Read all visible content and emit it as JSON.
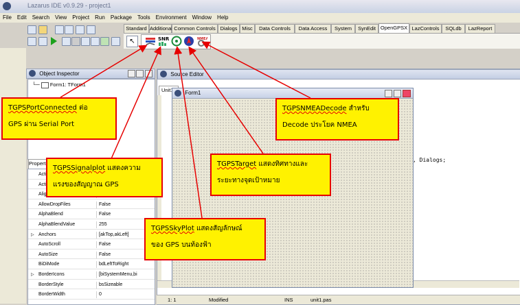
{
  "window": {
    "title": "Lazarus IDE v0.9.29 - project1"
  },
  "menu": [
    "File",
    "Edit",
    "Search",
    "View",
    "Project",
    "Run",
    "Package",
    "Tools",
    "Environment",
    "Window",
    "Help"
  ],
  "palette_tabs": [
    "Standard",
    "Additional",
    "Common Controls",
    "Dialogs",
    "Misc",
    "Data Controls",
    "Data Access",
    "System",
    "SynEdit",
    "OpenGPSX",
    "LazControls",
    "SQLdb",
    "LazReport"
  ],
  "active_tab": "OpenGPSX",
  "palette_components": [
    {
      "name": "TGPSPortConnected",
      "icon": "gps-port-icon"
    },
    {
      "name": "TGPSSignalplot",
      "icon": "snr-signal-icon"
    },
    {
      "name": "TGPSSkyPlot",
      "icon": "sky-plot-icon"
    },
    {
      "name": "TGPSTarget",
      "icon": "target-icon"
    },
    {
      "name": "TGPSNMEADecode",
      "icon": "nmea-decode-icon"
    }
  ],
  "object_inspector": {
    "title": "Object Inspector",
    "tree_item": "Form1: TForm1",
    "tab": "Properties",
    "properties": [
      {
        "k": "Action",
        "v": ""
      },
      {
        "k": "ActiveControl",
        "v": ""
      },
      {
        "k": "Align",
        "v": ""
      },
      {
        "k": "AllowDropFiles",
        "v": "False"
      },
      {
        "k": "AlphaBlend",
        "v": "False"
      },
      {
        "k": "AlphaBlendValue",
        "v": "255"
      },
      {
        "k": "Anchors",
        "v": "[akTop,akLeft]",
        "expand": true
      },
      {
        "k": "AutoScroll",
        "v": "False"
      },
      {
        "k": "AutoSize",
        "v": "False"
      },
      {
        "k": "BiDiMode",
        "v": "bdLeftToRight"
      },
      {
        "k": "BorderIcons",
        "v": "[biSystemMenu,bi",
        "expand": true
      },
      {
        "k": "BorderStyle",
        "v": "bsSizeable"
      },
      {
        "k": "BorderWidth",
        "v": "0"
      }
    ]
  },
  "source_editor": {
    "title": "Source Editor",
    "tab": "Unit1",
    "code_fragment": ", Dialogs;"
  },
  "form1": {
    "title": "Form1"
  },
  "statusbar": {
    "pos": "1: 1",
    "state": "Modified",
    "mode": "INS",
    "file": "unit1.pas"
  },
  "callouts": {
    "port": {
      "name": "TGPSPortConnected",
      "text1": " ต่อ",
      "text2": "GPS ผ่าน Serial Port"
    },
    "signal": {
      "name": "TGPSSignalplot",
      "text1": " แสดงความ",
      "text2": "แรงของสัญญาณ GPS"
    },
    "sky": {
      "name": "TGPSSkyPlot",
      "text1": " แสดงสัญลักษณ์",
      "text2": "ของ GPS บนท้องฟ้า"
    },
    "target": {
      "name": "TGPSTarget",
      "text1": " แสดงทิศทางและ",
      "text2": "ระยะทางจุดเป้าหมาย"
    },
    "nmea": {
      "name": "TGPSNMEADecode",
      "text1": " สำหรับ",
      "text2": "Decode ประโยค NMEA"
    }
  },
  "colors": {
    "callout_bg": "#fff200",
    "arrow": "#e60000"
  }
}
